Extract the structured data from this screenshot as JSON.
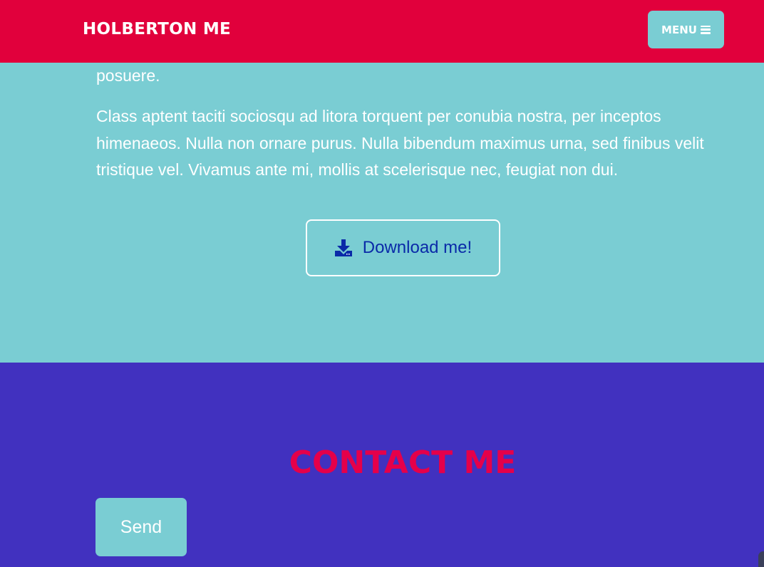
{
  "colors": {
    "nav_bg": "#e1003c",
    "about_bg": "#7acdd3",
    "contact_bg": "#4131bf",
    "accent_red": "#e5004a",
    "download_text": "#0a2aa8"
  },
  "navbar": {
    "brand": "HOLBERTON ME",
    "menu_label": "MENU",
    "menu_icon": "bars-icon"
  },
  "about": {
    "paragraphs": [
      "posuere.",
      "Class aptent taciti sociosqu ad litora torquent per conubia nostra, per inceptos himenaeos. Nulla non ornare purus. Nulla bibendum maximus urna, sed finibus velit tristique vel. Vivamus ante mi, mollis at scelerisque nec, feugiat non dui."
    ],
    "download_label": "Download me!",
    "download_icon": "download-icon"
  },
  "contact": {
    "title": "CONTACT ME",
    "send_label": "Send"
  }
}
